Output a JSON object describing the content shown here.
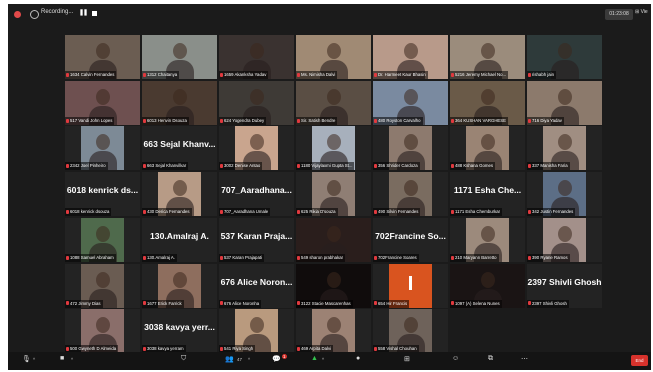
{
  "topbar": {
    "recording_label": "Recording...",
    "pause_symbol": "❚❚",
    "timer": "01:23:08",
    "view_label": "⊞ Vie"
  },
  "tiles": [
    {
      "name": "1634 Calvin Fernandes",
      "style": "photo",
      "bg": "#6b5d52"
    },
    {
      "name": "1312 Chaitanya",
      "style": "photo",
      "bg": "#8a8f8a",
      "selected": true
    },
    {
      "name": "1659 Akanksha Yadav",
      "style": "photo",
      "bg": "#3a3230"
    },
    {
      "name": "Ms. Nimisha Dalvi",
      "style": "photo",
      "bg": "#a08a74"
    },
    {
      "name": "Dr. Harmeet Kaur Bhasin",
      "style": "photo",
      "bg": "#b89a8a"
    },
    {
      "name": "5216 Jeremy Michael No...",
      "style": "photo",
      "bg": "#9b8c7c"
    },
    {
      "name": "rishabh jain",
      "style": "photo",
      "bg": "#2e3a3a"
    },
    {
      "name": "517 Vandi John Lopes",
      "style": "photo",
      "bg": "#6e5050"
    },
    {
      "name": "6013 Henvin Dsouza",
      "style": "photo",
      "bg": "#4a3a30"
    },
    {
      "name": "624 Yogendra Dubey",
      "style": "photo",
      "bg": "#3e3a36"
    },
    {
      "name": "Sir. Satish Bendre",
      "style": "photo",
      "bg": "#5a4e44"
    },
    {
      "name": "480 Royston Carvalho",
      "style": "photo",
      "bg": "#7a8aa0"
    },
    {
      "name": "364 KUSHAN VARGHESE",
      "style": "photo",
      "bg": "#6a5a48"
    },
    {
      "name": "716 Diya Yadav",
      "style": "photo",
      "bg": "#8c7a6c"
    },
    {
      "name": "2342 Joel Pinheiro",
      "style": "square",
      "bg": "#7d8a96"
    },
    {
      "name": "663 Sejal Khanvilkar",
      "style": "text",
      "big": "663 Sejal Khanv..."
    },
    {
      "name": "3002 Denise Antao",
      "style": "square",
      "bg": "#c9a58e"
    },
    {
      "name": "1180 Vijaylaxmi Gupta St...",
      "style": "square",
      "bg": "#a7b0bc"
    },
    {
      "name": "356 Shrider Cardoza",
      "style": "square",
      "bg": "#8d7a6e"
    },
    {
      "name": "488 Kshana Gomes",
      "style": "square",
      "bg": "#9a8474"
    },
    {
      "name": "337 Manisha Faria",
      "style": "square",
      "bg": "#a08e82"
    },
    {
      "name": "6018 kenrick dsouza",
      "style": "text",
      "big": "6018 kenrick ds..."
    },
    {
      "name": "430 Derica Fernandes",
      "style": "square",
      "bg": "#b79b86"
    },
    {
      "name": "707_Aaradhana Umale",
      "style": "text",
      "big": "707_Aaradhana..."
    },
    {
      "name": "625 Rikia D'souza",
      "style": "square",
      "bg": "#8f7e74"
    },
    {
      "name": "490 Silvin Fernandes",
      "style": "square",
      "bg": "#7a6c60"
    },
    {
      "name": "1171 Esha Chemburkar",
      "style": "text",
      "big": "1171 Esha Che..."
    },
    {
      "name": "342 Justin Fernandes",
      "style": "square",
      "bg": "#5c6e86"
    },
    {
      "name": "1088 Samuel Abraham",
      "style": "square",
      "bg": "#4f6a4c"
    },
    {
      "name": "130.Amalraj A.",
      "style": "text",
      "big": "130.Amalraj A."
    },
    {
      "name": "537 Karan Prajapati",
      "style": "text",
      "big": "537 Karan Praja..."
    },
    {
      "name": "549 sharon prabhakar",
      "style": "photo",
      "bg": "#2a1e1c"
    },
    {
      "name": "702Francine Soares",
      "style": "text",
      "big": "702Francine So..."
    },
    {
      "name": "210 Maryann Barretto",
      "style": "square",
      "bg": "#9c8a7c"
    },
    {
      "name": "390 Ryane Ramos",
      "style": "square",
      "bg": "#a3908a"
    },
    {
      "name": "472 Jimmy Dias",
      "style": "square",
      "bg": "#6a5c52"
    },
    {
      "name": "1677 Erick Farrick",
      "style": "square",
      "bg": "#8e6e5e"
    },
    {
      "name": "676 Alice Noronha",
      "style": "text",
      "big": "676 Alice Noron..."
    },
    {
      "name": "3122 Stacie Mascarenhas",
      "style": "photo",
      "bg": "#100c0c"
    },
    {
      "name": "654 Hir Francis",
      "style": "orange",
      "bg": "#d9541f"
    },
    {
      "name": "1097 (A) Selena Nunes",
      "style": "photo",
      "bg": "#1a1414"
    },
    {
      "name": "2397 Shivli Ghosh",
      "style": "text",
      "big": "2397 Shivli Ghosh"
    },
    {
      "name": "500 Gwyneth D Almeida",
      "style": "square",
      "bg": "#8a6e6a"
    },
    {
      "name": "3038 kavya yerram",
      "style": "text",
      "big": "3038 kavya yerr..."
    },
    {
      "name": "541 Riya Singh",
      "style": "square",
      "bg": "#b99a7e"
    },
    {
      "name": "469 Arpita Dalvi",
      "style": "square",
      "bg": "#9c8274"
    },
    {
      "name": "558 Vishal Chouhan",
      "style": "square",
      "bg": "#6e625a"
    }
  ],
  "toolbar": {
    "participants_count": "47",
    "chat_badge": "1",
    "end_label": "End"
  },
  "colors": {
    "background": "#1b1b1b",
    "mic_muted": "#e0393e",
    "selected_border": "#8cd63a",
    "end_button": "#d7322c",
    "orange_tile": "#d9541f"
  }
}
